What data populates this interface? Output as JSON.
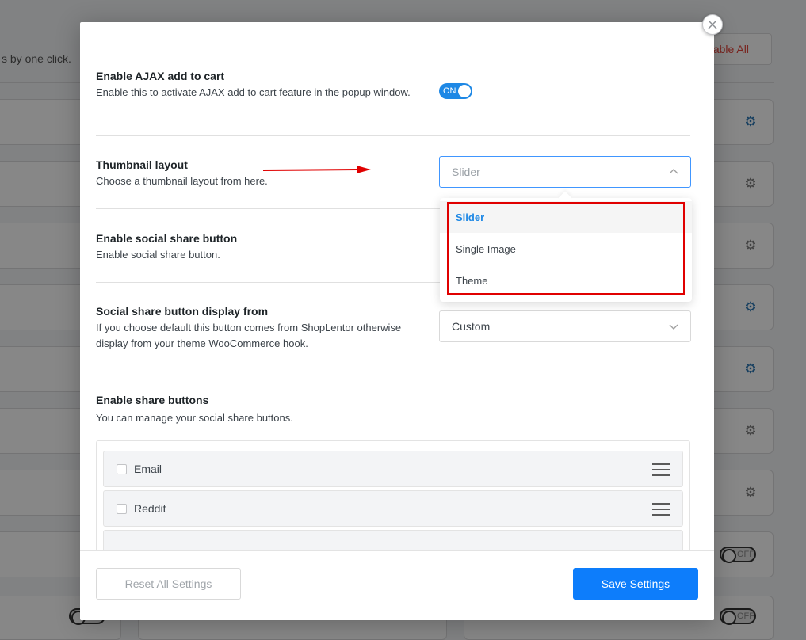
{
  "background": {
    "subtitle": "s by one click.",
    "enable_all_label": "able All",
    "toggle_off_label": "OFF"
  },
  "modal": {
    "close_icon": "close-icon",
    "settings": [
      {
        "title": "Enable AJAX add to cart",
        "description": "Enable this to activate AJAX add to cart feature in the popup window.",
        "toggle_label": "ON"
      },
      {
        "title": "Thumbnail layout",
        "description": "Choose a thumbnail layout from here.",
        "select_value": "Slider",
        "options": [
          "Slider",
          "Single Image",
          "Theme"
        ],
        "selected_option": "Slider"
      },
      {
        "title": "Enable social share button",
        "description": "Enable social share button."
      },
      {
        "title": "Social share button display from",
        "description": "If you choose default this button comes from ShopLentor otherwise display from your theme WooCommerce hook.",
        "select_value": "Custom"
      },
      {
        "title": "Enable share buttons",
        "description": "You can manage your social share buttons.",
        "items": [
          "Email",
          "Reddit"
        ]
      }
    ],
    "footer": {
      "reset_label": "Reset All Settings",
      "save_label": "Save Settings"
    }
  },
  "colors": {
    "primary": "#0d7dfb",
    "toggle_on": "#1e88e5",
    "annotation_red": "#e00000"
  }
}
